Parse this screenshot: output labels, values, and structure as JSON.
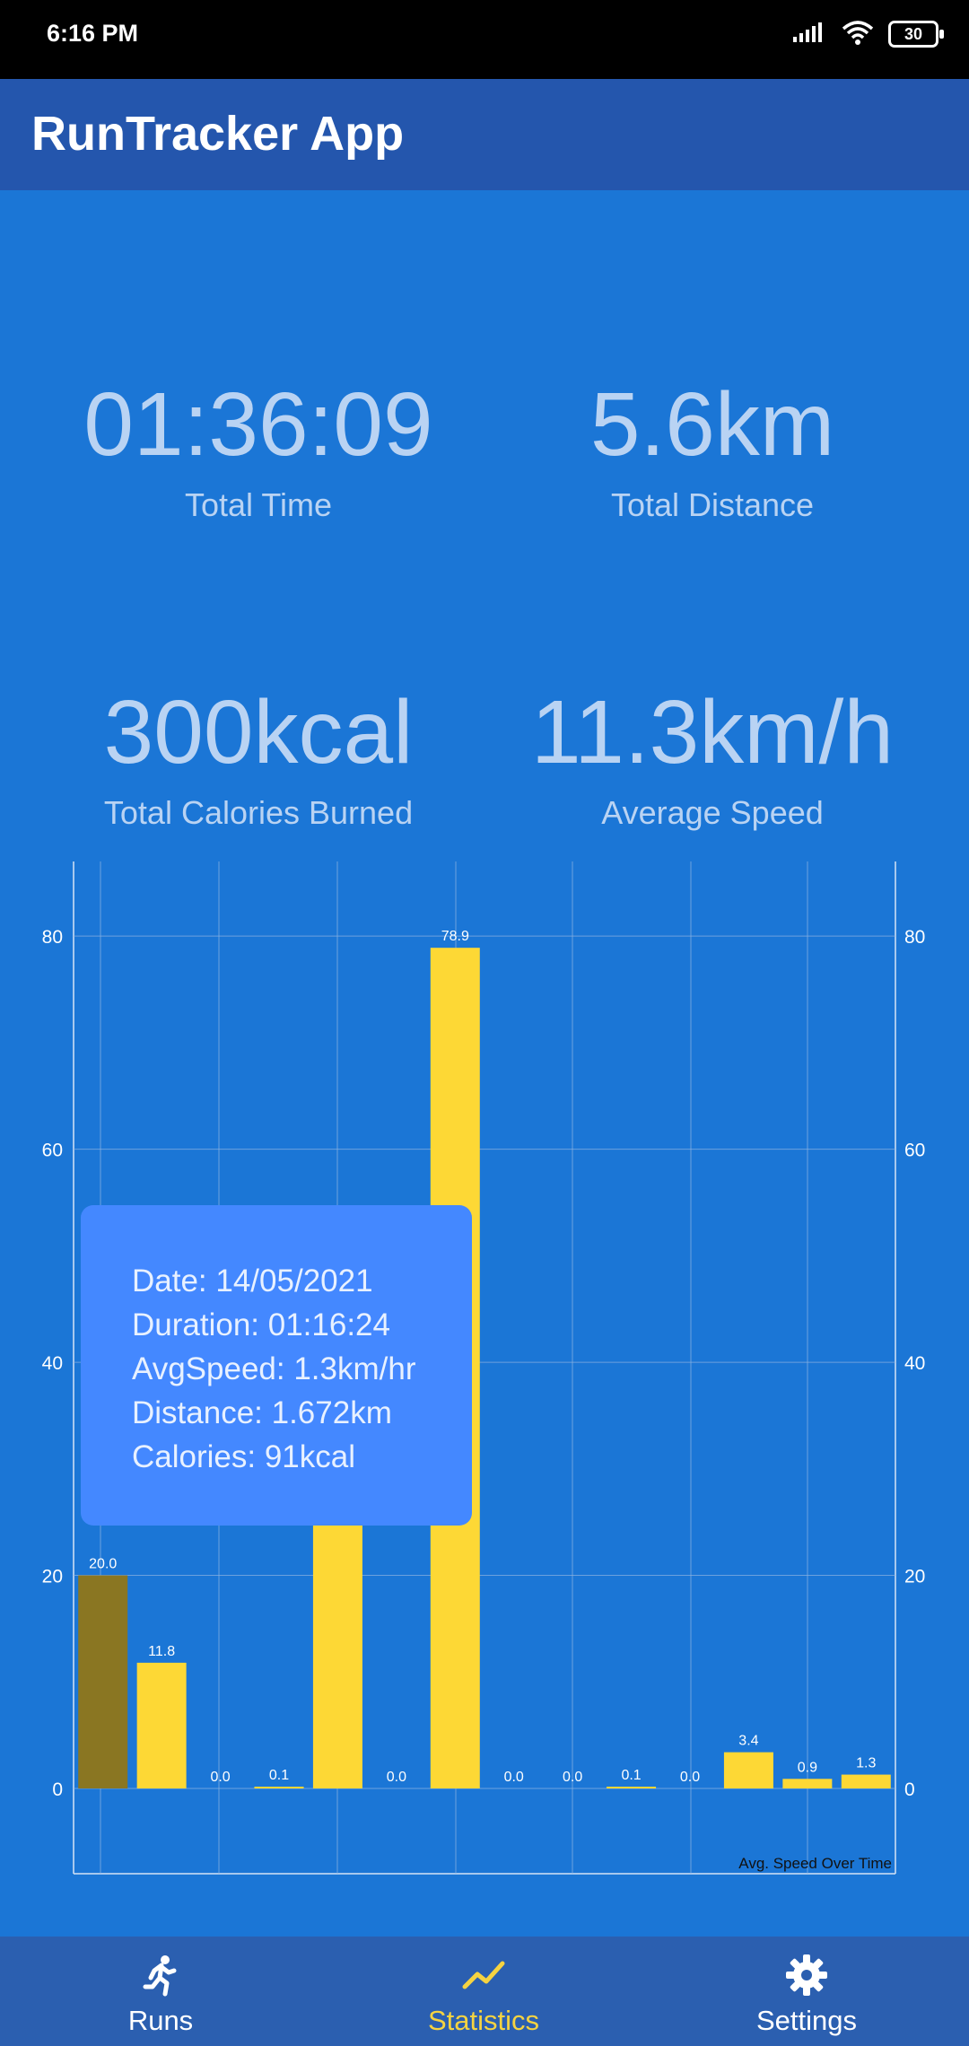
{
  "status_bar": {
    "time": "6:16 PM",
    "battery": "30"
  },
  "app_bar": {
    "title": "RunTracker App"
  },
  "stats": {
    "total_time": {
      "value": "01:36:09",
      "label": "Total Time"
    },
    "total_distance": {
      "value": "5.6km",
      "label": "Total Distance"
    },
    "total_calories": {
      "value": "300kcal",
      "label": "Total Calories Burned"
    },
    "average_speed": {
      "value": "11.3km/h",
      "label": "Average Speed"
    }
  },
  "tooltip": {
    "date": "Date: 14/05/2021",
    "duration": "Duration: 01:16:24",
    "avg_speed": "AvgSpeed: 1.3km/hr",
    "distance": "Distance: 1.672km",
    "calories": "Calories: 91kcal"
  },
  "chart_data": {
    "type": "bar",
    "description_label": "Avg. Speed Over Time",
    "values": [
      20.0,
      11.8,
      0.0,
      0.1,
      25.0,
      0.0,
      78.9,
      0.0,
      0.0,
      0.1,
      0.0,
      3.4,
      0.9,
      1.3
    ],
    "value_labels": [
      "20.0",
      "11.8",
      "0.0",
      "0.1",
      "",
      "0.0",
      "78.9",
      "0.0",
      "0.0",
      "0.1",
      "0.0",
      "3.4",
      "0.9",
      "1.3"
    ],
    "selected_index": 0,
    "ylim": [
      -8,
      87
    ],
    "y_ticks": [
      0,
      20,
      40,
      60,
      80
    ],
    "y_tick_labels": [
      "0",
      "20",
      "40",
      "60",
      "80"
    ],
    "grid": true,
    "colors": {
      "bar": "#fdd835",
      "selected_bar": "#8a7622",
      "grid": "#8fb4e0",
      "text": "#ffffff"
    }
  },
  "bottom_nav": {
    "items": [
      {
        "label": "Runs",
        "icon": "runner-icon",
        "active": false
      },
      {
        "label": "Statistics",
        "icon": "trend-icon",
        "active": true
      },
      {
        "label": "Settings",
        "icon": "gear-icon",
        "active": false
      }
    ]
  }
}
